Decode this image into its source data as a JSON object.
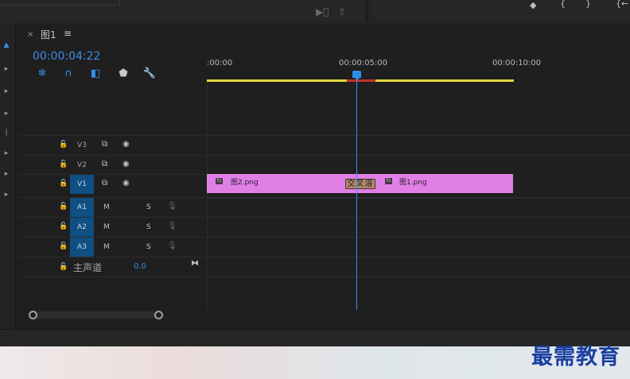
{
  "top": {
    "panel_icons": [
      "▶⃞",
      "⇪"
    ],
    "right_icons": [
      "◆",
      "{",
      "}",
      "{←"
    ]
  },
  "tab": {
    "close": "×",
    "title": "图1",
    "menu": "≡"
  },
  "timecode": "00:00:04:22",
  "controls": [
    "snowflake-icon",
    "magnet-icon",
    "linked-selection-icon",
    "marker-icon",
    "wrench-icon"
  ],
  "ruler": {
    "labels": [
      ":00:00",
      "00:00:05:00",
      "00:00:10:00"
    ]
  },
  "video_tracks": [
    {
      "label": "V3",
      "active": false
    },
    {
      "label": "V2",
      "active": false
    },
    {
      "label": "V1",
      "active": true
    }
  ],
  "audio_tracks": [
    {
      "label": "A1",
      "m": "M",
      "s": "S"
    },
    {
      "label": "A2",
      "m": "M",
      "s": "S"
    },
    {
      "label": "A3",
      "m": "M",
      "s": "S"
    }
  ],
  "master": {
    "label": "主声道",
    "value": "0.0"
  },
  "clips": {
    "first": "图2.png",
    "second": "图1.png",
    "fx": "fx",
    "transition": "交叉溶"
  },
  "watermark": "最需教育",
  "colors": {
    "accent": "#2e8ee6",
    "clip": "#e080e6",
    "track_active": "#0f4f82",
    "ruler": "#e2d43a"
  }
}
